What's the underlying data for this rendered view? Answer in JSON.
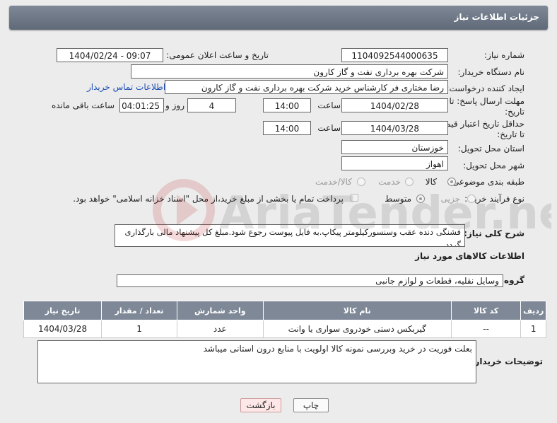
{
  "header": {
    "title": "جزئیات اطلاعات نیاز"
  },
  "labels": {
    "need_number": "شماره نیاز:",
    "announce_datetime": "تاریخ و ساعت اعلان عمومی:",
    "buyer_org": "نام دستگاه خریدار:",
    "requester": "ایجاد کننده درخواست:",
    "buyer_contact": "اطلاعات تماس خریدار",
    "reply_deadline_1": "مهلت ارسال پاسخ: تا",
    "reply_deadline_2": "تاریخ:",
    "price_valid_1": "حداقل تاریخ اعتبار قیمت:",
    "price_valid_2": "تا تاریخ:",
    "time": "ساعت",
    "day_and": "روز و",
    "hours_left": "ساعت باقی مانده",
    "province": "استان محل تحویل:",
    "city": "شهر محل تحویل:",
    "category": "طبقه بندی موضوعی:",
    "process": "نوع فرآیند خرید :",
    "description": "شرح کلی نیاز:",
    "goods_info": "اطلاعات کالاهای مورد نیاز",
    "goods_group": "گروه کالا:",
    "buyer_notes": "توضیحات خریدار:"
  },
  "fields": {
    "need_number": "1104092544000635",
    "announce_datetime": "1404/02/24 - 09:07",
    "buyer_org": "شرکت بهره برداری نفت و گاز کارون",
    "requester": "رضا مختاری فر کارشناس خرید شرکت بهره برداری نفت و گاز کارون",
    "reply_date": "1404/02/28",
    "reply_time": "14:00",
    "days": "4",
    "remaining": "04:01:25",
    "price_date": "1404/03/28",
    "price_time": "14:00",
    "province": "خوزستان",
    "city": "اهواز",
    "description": "فشنگی دنده عقب وسنسورکیلومتر پیکاپ.به فایل پیوست رجوع شود.مبلغ کل پیشنهاد مالی بارگذاری گردد",
    "goods_group": "وسایل نقلیه، قطعات و لوازم جانبی",
    "buyer_notes": "بعلت فوریت در خرید وبررسی نمونه کالا اولویت با منابع درون استانی میباشد"
  },
  "category_options": [
    {
      "label": "کالا",
      "selected": true
    },
    {
      "label": "خدمت",
      "selected": false
    },
    {
      "label": "کالا/خدمت",
      "selected": false
    }
  ],
  "process_options": [
    {
      "label": "جزیی",
      "selected": false
    },
    {
      "label": "متوسط",
      "selected": true
    }
  ],
  "payment_note": "پرداخت تمام یا بخشی از مبلغ خرید،از محل \"اسناد خزانه اسلامی\" خواهد بود.",
  "table": {
    "headers": [
      "ردیف",
      "کد کالا",
      "نام کالا",
      "واحد شمارش",
      "تعداد / مقدار",
      "تاریخ نیاز"
    ],
    "rows": [
      [
        "1",
        "--",
        "گیربکس دستی خودروی سواری یا وانت",
        "عدد",
        "1",
        "1404/03/28"
      ]
    ]
  },
  "buttons": {
    "print": "چاپ",
    "back": "بازگشت"
  },
  "watermark": "AriaTender.net"
}
